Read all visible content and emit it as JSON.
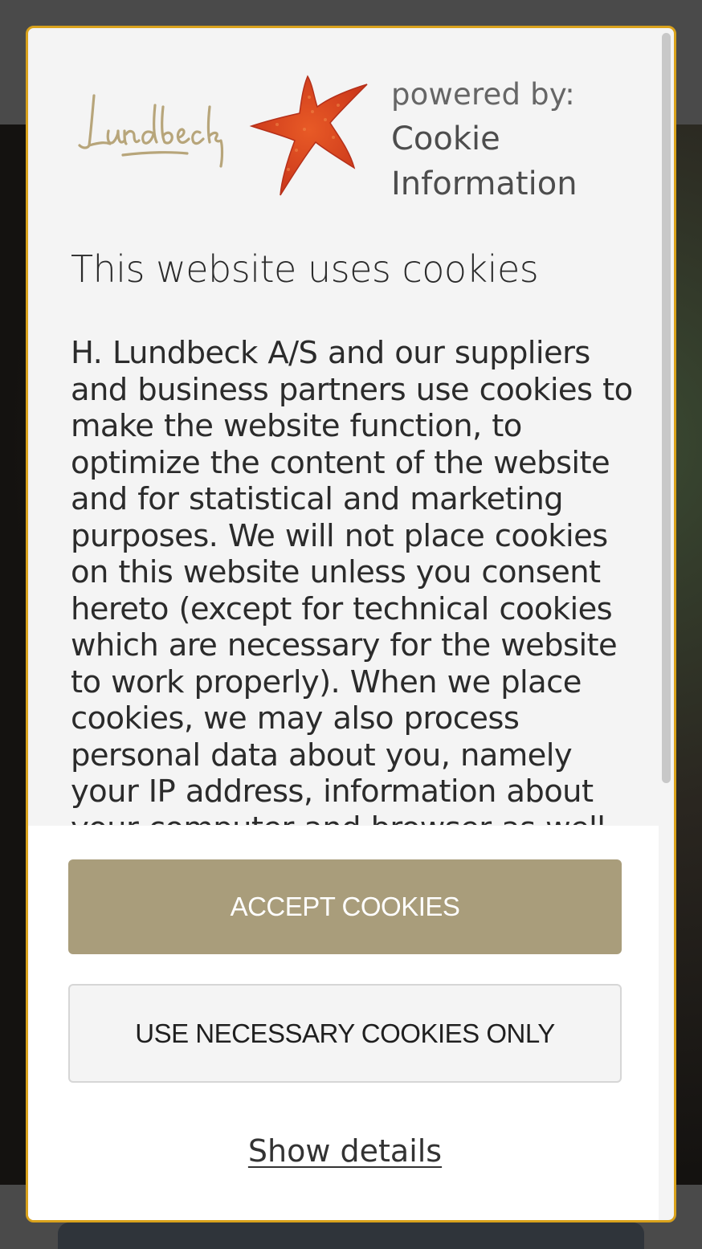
{
  "dialog": {
    "brand": {
      "company_logo_text": "Lundbeck",
      "powered_by_label": "powered by:",
      "provider_name_line1": "Cookie",
      "provider_name_line2": "Information"
    },
    "title": "This website uses cookies",
    "body": "H. Lundbeck A/S and our suppliers and business partners use cookies to make the website function, to optimize the content of the website and for statistical and marketing purposes. We will not place cookies on this website unless you consent hereto (except for technical cookies which are necessary for the website to work properly). When we place cookies, we may also process personal data about you, namely your IP address, information about your computer and browser as well",
    "buttons": {
      "accept_label": "ACCEPT COOKIES",
      "necessary_label": "USE NECESSARY COOKIES ONLY",
      "details_label": "Show details"
    }
  },
  "colors": {
    "accent_border": "#d9a21c",
    "accept_button": "#a99d7b",
    "star_logo": "#d9421c",
    "lundbeck_logo": "#b7a57a"
  }
}
